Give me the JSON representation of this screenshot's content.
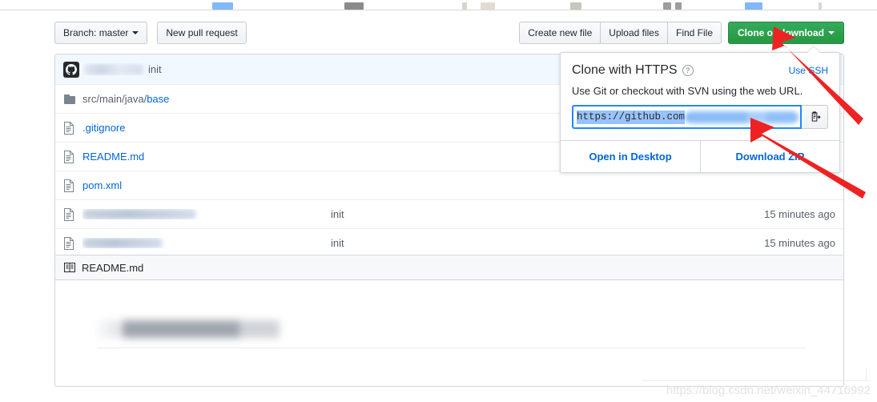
{
  "colors": {
    "accent_green": "#2ea44f",
    "link_blue": "#0366d6",
    "selection_blue": "#98c2fb",
    "row_highlight": "#f1f8ff",
    "border": "#d1d5da",
    "annotation_red": "#ee2222"
  },
  "toolbar": {
    "branch_button": "Branch: master",
    "new_pull_request": "New pull request",
    "create_new_file": "Create new file",
    "upload_files": "Upload files",
    "find_file": "Find File",
    "clone_or_download": "Clone or download"
  },
  "file_list": {
    "latest_commit": {
      "avatar_icon": "github-avatar-icon",
      "author_blurred": "",
      "message": "init"
    },
    "rows": [
      {
        "icon": "folder-icon",
        "name_prefix": "src/main/java/",
        "name_link": "base",
        "blurred": false,
        "message": "",
        "age": ""
      },
      {
        "icon": "file-icon",
        "name_prefix": "",
        "name_link": ".gitignore",
        "blurred": false,
        "message": "",
        "age": ""
      },
      {
        "icon": "file-icon",
        "name_prefix": "",
        "name_link": "README.md",
        "blurred": false,
        "message": "",
        "age": ""
      },
      {
        "icon": "file-icon",
        "name_prefix": "",
        "name_link": "pom.xml",
        "blurred": false,
        "message": "",
        "age": ""
      },
      {
        "icon": "file-icon",
        "name_prefix": "",
        "name_link": "",
        "blurred": true,
        "blur_width": 142,
        "message": "init",
        "age": "15 minutes ago"
      },
      {
        "icon": "file-icon",
        "name_prefix": "",
        "name_link": "",
        "blurred": true,
        "blur_width": 100,
        "message": "init",
        "age": "15 minutes ago"
      }
    ]
  },
  "clone_panel": {
    "title": "Clone with HTTPS",
    "help_icon": "question-mark-icon",
    "use_ssh_link": "Use SSH",
    "description": "Use Git or checkout with SVN using the web URL.",
    "url_value": "https://github.com",
    "url_is_selected": true,
    "copy_icon": "clipboard-copy-icon",
    "open_in_desktop": "Open in Desktop",
    "download_zip": "Download ZIP"
  },
  "readme": {
    "header_icon": "book-icon",
    "header_title": "README.md"
  },
  "watermark": {
    "text": "https://blog.csdn.net/weixin_44716992"
  }
}
